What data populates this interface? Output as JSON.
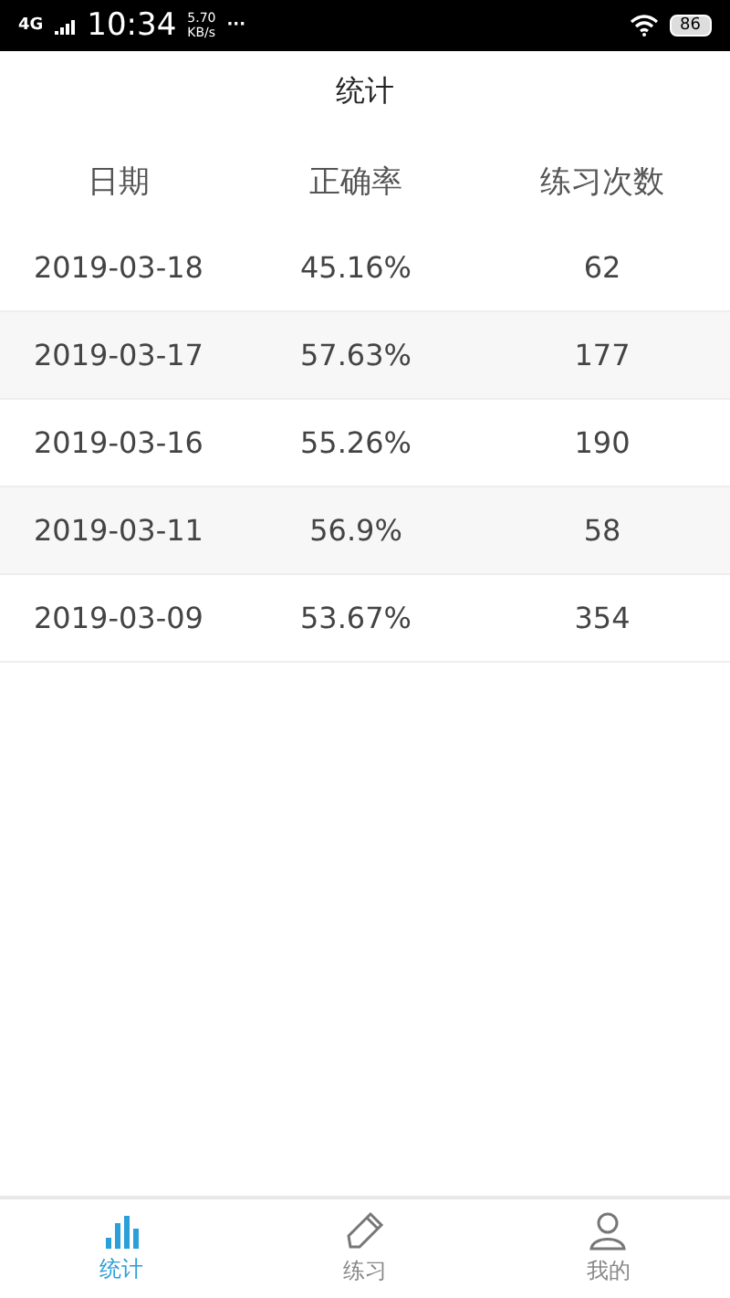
{
  "status_bar": {
    "network": "4G",
    "time": "10:34",
    "speed": "5.70",
    "speed_unit": "KB/s",
    "more": "···",
    "battery": "86"
  },
  "title": "统计",
  "table": {
    "columns": [
      "日期",
      "正确率",
      "练习次数"
    ],
    "rows": [
      [
        "2019-03-18",
        "45.16%",
        "62"
      ],
      [
        "2019-03-17",
        "57.63%",
        "177"
      ],
      [
        "2019-03-16",
        "55.26%",
        "190"
      ],
      [
        "2019-03-11",
        "56.9%",
        "58"
      ],
      [
        "2019-03-09",
        "53.67%",
        "354"
      ]
    ]
  },
  "tabs": [
    {
      "label": "统计",
      "kind": "chart",
      "selected": true
    },
    {
      "label": "练习",
      "kind": "pencil",
      "selected": false
    },
    {
      "label": "我的",
      "kind": "person",
      "selected": false
    }
  ]
}
